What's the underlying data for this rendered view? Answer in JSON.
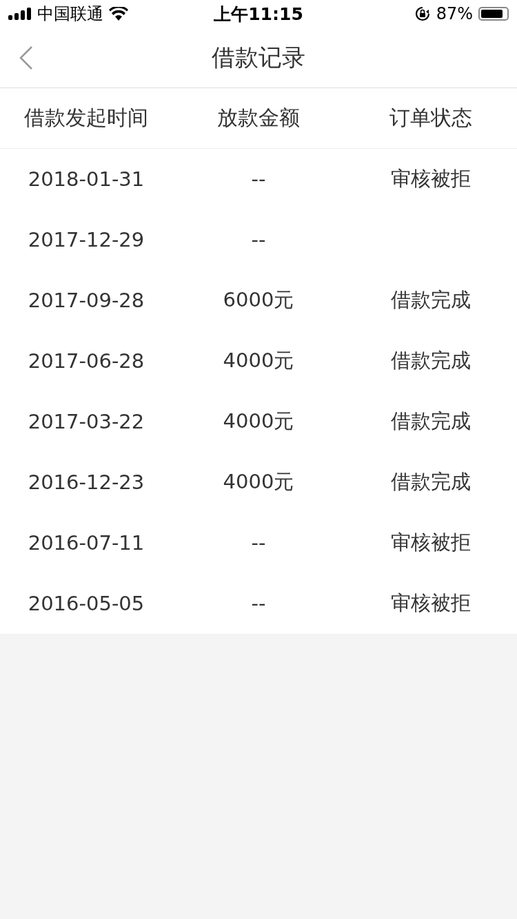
{
  "status_bar": {
    "carrier": "中国联通",
    "time": "上午11:15",
    "battery": "87%"
  },
  "nav": {
    "title": "借款记录"
  },
  "table": {
    "columns": [
      "借款发起时间",
      "放款金额",
      "订单状态"
    ],
    "rows": [
      {
        "date": "2018-01-31",
        "amount": "--",
        "status": "审核被拒"
      },
      {
        "date": "2017-12-29",
        "amount": "--"
      },
      {
        "date": "2017-09-28",
        "amount": "6000元",
        "status": "借款完成"
      },
      {
        "date": "2017-06-28",
        "amount": "4000元",
        "status": "借款完成"
      },
      {
        "date": "2017-03-22",
        "amount": "4000元",
        "status": "借款完成"
      },
      {
        "date": "2016-12-23",
        "amount": "4000元",
        "status": "借款完成"
      },
      {
        "date": "2016-07-11",
        "amount": "--",
        "status": "审核被拒"
      },
      {
        "date": "2016-05-05",
        "amount": "--",
        "status": "审核被拒"
      }
    ]
  }
}
